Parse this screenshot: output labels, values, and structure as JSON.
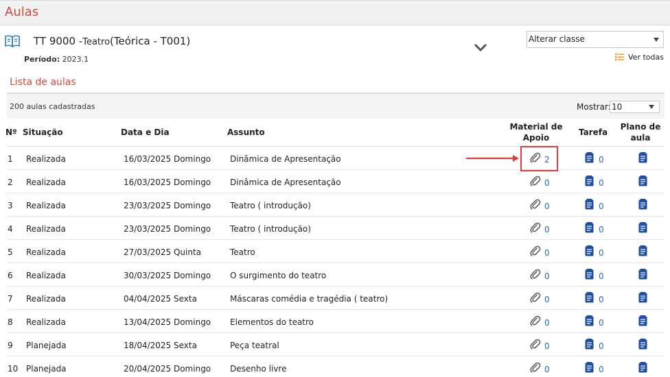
{
  "page": {
    "title": "Aulas"
  },
  "class_header": {
    "code": "TT",
    "number": "9000",
    "separator": " -",
    "name": "Teatro",
    "type": "(Teórica - T001)",
    "periodo_label": "Período:",
    "periodo_value": "2023.1"
  },
  "class_selector": {
    "selected": "Alterar classe"
  },
  "ver_todas": "Ver todas",
  "section_title": "Lista de aulas",
  "count_text": "200 aulas cadastradas",
  "mostrar": {
    "label": "Mostrar:",
    "value": "10"
  },
  "table": {
    "headers": {
      "num": "Nº",
      "situacao": "Situação",
      "data": "Data e Dia",
      "assunto": "Assunto",
      "material_line1": "Material de",
      "material_line2": "Apoio",
      "tarefa": "Tarefa",
      "plano_line1": "Plano de",
      "plano_line2": "aula"
    },
    "rows": [
      {
        "num": "1",
        "situacao": "Realizada",
        "data": "16/03/2025 Domingo",
        "assunto": "Dinâmica de Apresentação",
        "material": "2",
        "tarefa": "0"
      },
      {
        "num": "2",
        "situacao": "Realizada",
        "data": "16/03/2025 Domingo",
        "assunto": "Dinâmica de Apresentação",
        "material": "0",
        "tarefa": "0"
      },
      {
        "num": "3",
        "situacao": "Realizada",
        "data": "23/03/2025 Domingo",
        "assunto": "Teatro ( introdução)",
        "material": "0",
        "tarefa": "0"
      },
      {
        "num": "4",
        "situacao": "Realizada",
        "data": "23/03/2025 Domingo",
        "assunto": "Teatro ( introdução)",
        "material": "0",
        "tarefa": "0"
      },
      {
        "num": "5",
        "situacao": "Realizada",
        "data": "27/03/2025 Quinta",
        "assunto": "Teatro",
        "material": "0",
        "tarefa": "0"
      },
      {
        "num": "6",
        "situacao": "Realizada",
        "data": "30/03/2025 Domingo",
        "assunto": "O surgimento do teatro",
        "material": "0",
        "tarefa": "0"
      },
      {
        "num": "7",
        "situacao": "Realizada",
        "data": "04/04/2025 Sexta",
        "assunto": "Máscaras comédia e tragédia ( teatro)",
        "material": "0",
        "tarefa": "0"
      },
      {
        "num": "8",
        "situacao": "Realizada",
        "data": "13/04/2025 Domingo",
        "assunto": "Elementos do teatro",
        "material": "0",
        "tarefa": "0"
      },
      {
        "num": "9",
        "situacao": "Planejada",
        "data": "18/04/2025 Sexta",
        "assunto": "Peça teatral",
        "material": "0",
        "tarefa": "0"
      },
      {
        "num": "10",
        "situacao": "Planejada",
        "data": "20/04/2025 Domingo",
        "assunto": "Desenho livre",
        "material": "0",
        "tarefa": "0"
      }
    ]
  },
  "colors": {
    "accent": "#cf4a3a",
    "link": "#2b6cb0",
    "icon_blue": "#1f4f9c",
    "highlight": "#e23a3a"
  }
}
